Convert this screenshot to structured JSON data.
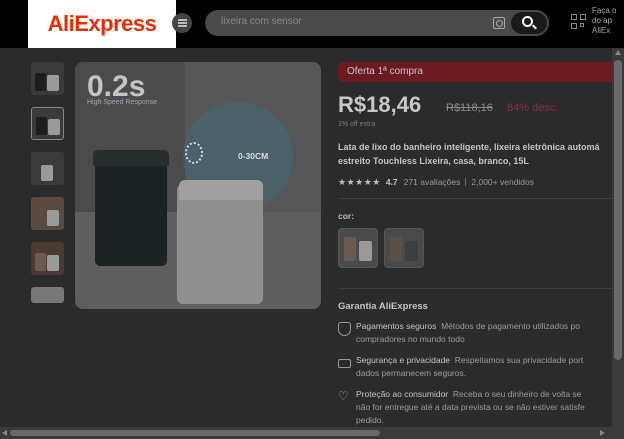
{
  "header": {
    "logo": "AliExpress",
    "search_placeholder": "lixeira com sensor",
    "app_prompt": [
      "Faça o",
      "do ap",
      "AliEx"
    ]
  },
  "gallery": {
    "thumbnail_count": 6,
    "active_index": 1,
    "main_image": {
      "speed": "0.2s",
      "speed_caption": "High Speed Response",
      "range": "0-30CM"
    }
  },
  "product": {
    "offer_banner": "Oferta 1ª compra",
    "price": "R$18,46",
    "old_price": "R$118,16",
    "discount": "84% desc.",
    "extra": "1% off extra",
    "title_line1": "Lata de lixo do banheiro inteligente, lixeira eletrônica automá",
    "title_line2": "estreito Touchless Lixeira, casa, branco, 15L",
    "rating": "4.7",
    "reviews": "271 avaliações",
    "sold": "2,000+ vendidos",
    "color_label": "cor:"
  },
  "guarantee": {
    "heading": "Garantia AliExpress",
    "items": [
      {
        "title": "Pagamentos seguros",
        "line1": "Métodos de pagamento utilizados po",
        "line2": "compradores no mundo todo"
      },
      {
        "title": "Segurança e privacidade",
        "line1": "Respeitamos sua privacidade port",
        "line2": "dados permanecem seguros."
      },
      {
        "title": "Proteção ao consumidor",
        "line1": "Receba o seu dinheiro de volta se",
        "line2": "não for entregue até a data prevista ou se não estiver satisfe",
        "line3": "pedido."
      }
    ]
  },
  "colors": {
    "accent": "#e62e04",
    "overlay": "#2b2b2b"
  }
}
